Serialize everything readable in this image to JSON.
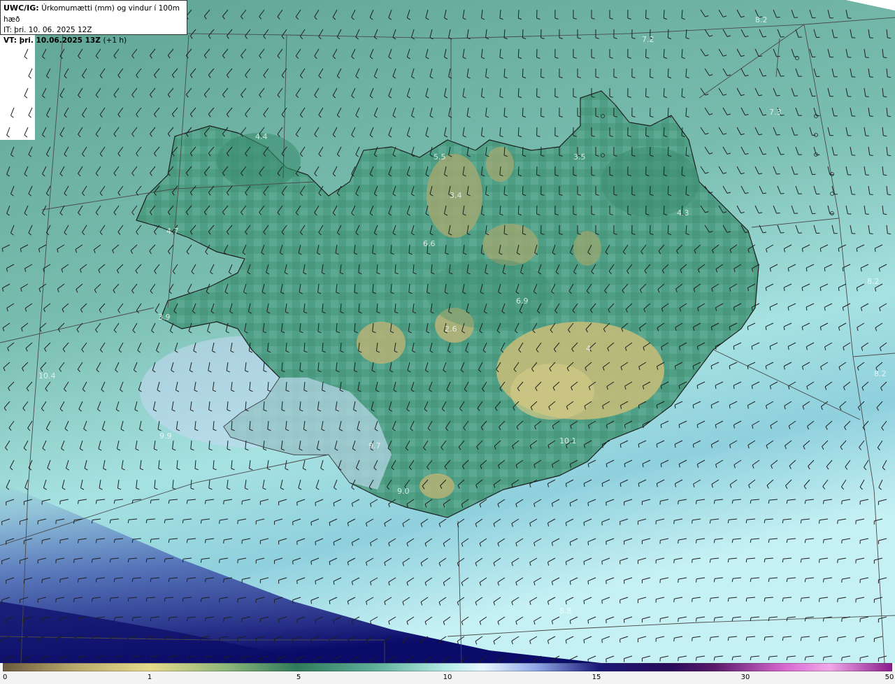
{
  "header": {
    "product": "UWC/IG:",
    "title": "Úrkomumætti (mm) og vindur í 100m hæð",
    "issue_time": "IT: þri. 10. 06. 2025 12Z",
    "valid_time_label": "VT: þri. 10.06.2025 13Z",
    "valid_offset": "(+1 h)"
  },
  "map_labels": [
    {
      "text": "8.2"
    },
    {
      "text": "7.2"
    },
    {
      "text": "7.3"
    },
    {
      "text": "4.4"
    },
    {
      "text": "4.7"
    },
    {
      "text": "3.4"
    },
    {
      "text": "4.3"
    },
    {
      "text": "8.2"
    },
    {
      "text": "3.9"
    },
    {
      "text": "2.6"
    },
    {
      "text": "6.9"
    },
    {
      "text": "8.2"
    },
    {
      "text": "10.4"
    },
    {
      "text": "9.9"
    },
    {
      "text": "9.7"
    },
    {
      "text": "10.1"
    },
    {
      "text": "9.0"
    },
    {
      "text": "8.8"
    },
    {
      "text": "4"
    },
    {
      "text": "5.5"
    },
    {
      "text": "6.6"
    },
    {
      "text": "3.5"
    }
  ],
  "colorbar": {
    "ticks": [
      "0",
      "1",
      "5",
      "10",
      "15",
      "30",
      "50"
    ],
    "colors": [
      "#6b5a3e",
      "#c9b777",
      "#e6d98a",
      "#8fb77a",
      "#2f7a5a",
      "#5fb09a",
      "#b6ece8",
      "#e8f7ff",
      "#8fa7e6",
      "#3b4aa6",
      "#1a1778",
      "#2a0a5a",
      "#8a2a8a",
      "#d96ad0",
      "#f0a8e8",
      "#8a1a8a"
    ]
  }
}
